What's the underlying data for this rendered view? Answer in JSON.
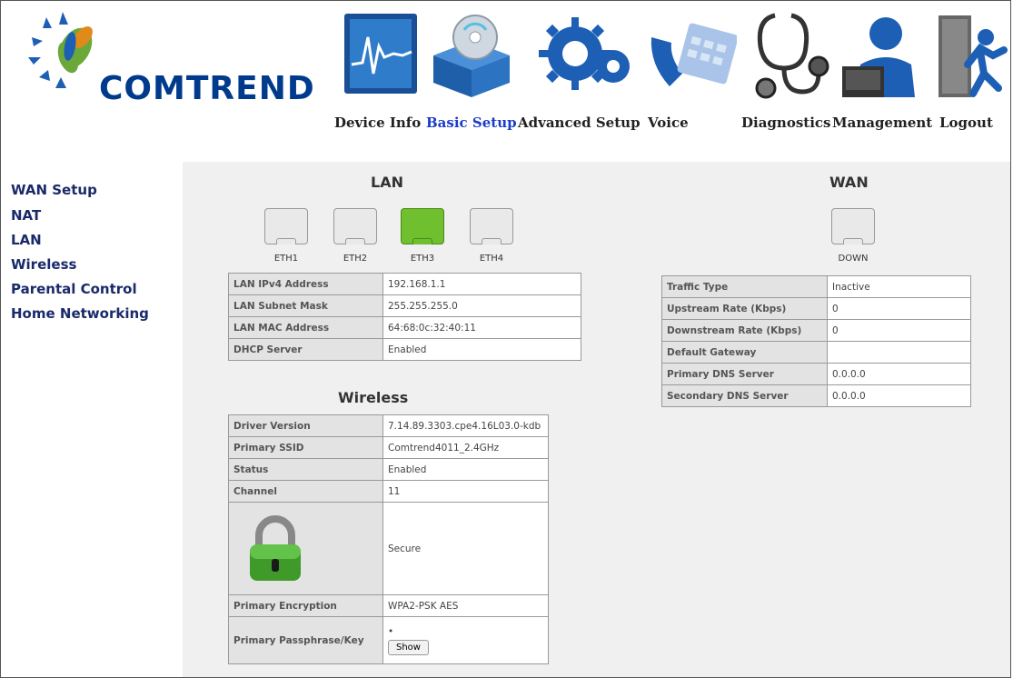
{
  "brand": {
    "name": "COMTREND"
  },
  "nav": {
    "items": [
      {
        "label": "Device Info",
        "icon": "chart-monitor-icon"
      },
      {
        "label": "Basic Setup",
        "icon": "box-disc-icon",
        "active": true
      },
      {
        "label": "Advanced Setup",
        "icon": "gears-icon"
      },
      {
        "label": "Voice",
        "icon": "phone-icon"
      },
      {
        "label": "Diagnostics",
        "icon": "stethoscope-icon"
      },
      {
        "label": "Management",
        "icon": "user-laptop-icon"
      },
      {
        "label": "Logout",
        "icon": "exit-door-icon"
      }
    ]
  },
  "sidebar": {
    "items": [
      {
        "label": "WAN Setup"
      },
      {
        "label": "NAT"
      },
      {
        "label": "LAN"
      },
      {
        "label": "Wireless"
      },
      {
        "label": "Parental Control"
      },
      {
        "label": "Home Networking"
      }
    ]
  },
  "lan": {
    "title": "LAN",
    "ports": [
      {
        "label": "ETH1",
        "active": false
      },
      {
        "label": "ETH2",
        "active": false
      },
      {
        "label": "ETH3",
        "active": true
      },
      {
        "label": "ETH4",
        "active": false
      }
    ],
    "rows": [
      {
        "key": "LAN IPv4 Address",
        "value": "192.168.1.1"
      },
      {
        "key": "LAN Subnet Mask",
        "value": "255.255.255.0"
      },
      {
        "key": "LAN MAC Address",
        "value": "64:68:0c:32:40:11"
      },
      {
        "key": "DHCP Server",
        "value": "Enabled"
      }
    ]
  },
  "wan": {
    "title": "WAN",
    "port": {
      "label": "DOWN",
      "active": false
    },
    "rows": [
      {
        "key": "Traffic Type",
        "value": "Inactive"
      },
      {
        "key": "Upstream Rate (Kbps)",
        "value": "0"
      },
      {
        "key": "Downstream Rate (Kbps)",
        "value": "0"
      },
      {
        "key": "Default Gateway",
        "value": ""
      },
      {
        "key": "Primary DNS Server",
        "value": "0.0.0.0"
      },
      {
        "key": "Secondary DNS Server",
        "value": "0.0.0.0"
      }
    ]
  },
  "wireless": {
    "title": "Wireless",
    "rows": [
      {
        "key": "Driver Version",
        "value": "7.14.89.3303.cpe4.16L03.0-kdb"
      },
      {
        "key": "Primary SSID",
        "value": "Comtrend4011_2.4GHz"
      },
      {
        "key": "Status",
        "value": "Enabled"
      },
      {
        "key": "Channel",
        "value": "11"
      }
    ],
    "security": {
      "icon": "padlock-icon",
      "value": "Secure"
    },
    "encryption": {
      "key": "Primary Encryption",
      "value": "WPA2-PSK AES"
    },
    "passphrase": {
      "key": "Primary Passphrase/Key",
      "masked": "•",
      "button": "Show"
    }
  }
}
